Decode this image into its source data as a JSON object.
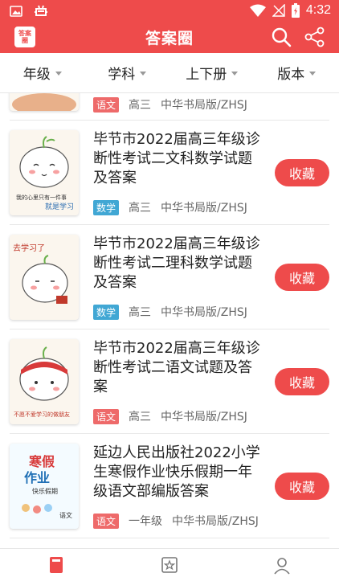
{
  "status_bar": {
    "time": "4:32",
    "app_icon": "bug-icon"
  },
  "app_bar": {
    "title": "答案圈",
    "logo_text": "答案圈",
    "accent": "#ee4b4b"
  },
  "filters": [
    {
      "label": "年级"
    },
    {
      "label": "学科"
    },
    {
      "label": "上下册"
    },
    {
      "label": "版本"
    }
  ],
  "partial_item": {
    "subject": "语文",
    "grade": "高三",
    "publisher": "中华书局版/ZHSJ"
  },
  "items": [
    {
      "title": "毕节市2022届高三年级诊断性考试二文科数学试题及答案",
      "subject": "数学",
      "grade": "高三",
      "publisher": "中华书局版/ZHSJ",
      "fav": "收藏",
      "thumb_caption": "我的心里只有一件事",
      "thumb_caption2": "就是学习"
    },
    {
      "title": "毕节市2022届高三年级诊断性考试二理科数学试题及答案",
      "subject": "数学",
      "grade": "高三",
      "publisher": "中华书局版/ZHSJ",
      "fav": "收藏",
      "thumb_caption": "去学习了"
    },
    {
      "title": "毕节市2022届高三年级诊断性考试二语文试题及答案",
      "subject": "语文",
      "grade": "高三",
      "publisher": "中华书局版/ZHSJ",
      "fav": "收藏",
      "thumb_caption": "不愿不爱学习的做朋友"
    },
    {
      "title": "延边人民出版社2022小学生寒假作业快乐假期一年级语文部编版答案",
      "subject": "语文",
      "grade": "一年级",
      "publisher": "中华书局版/ZHSJ",
      "fav": "收藏",
      "thumb_caption": "寒假",
      "thumb_caption2": "作业",
      "thumb_caption3": "快乐假期",
      "thumb_caption4": "语文"
    }
  ],
  "tabbar": {
    "icons": [
      "book-icon",
      "star-icon",
      "user-icon"
    ]
  }
}
